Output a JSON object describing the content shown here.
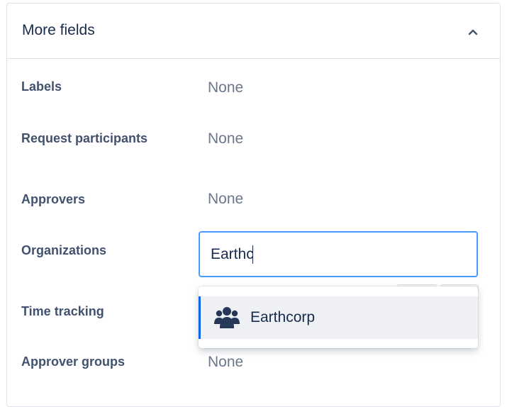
{
  "panel": {
    "title": "More fields"
  },
  "fields": {
    "labels": {
      "label": "Labels",
      "value": "None"
    },
    "request_participants": {
      "label": "Request participants",
      "value": "None"
    },
    "approvers": {
      "label": "Approvers",
      "value": "None"
    },
    "organizations": {
      "label": "Organizations",
      "input_value": "Earthc"
    },
    "time_tracking": {
      "label": "Time tracking"
    },
    "approver_groups": {
      "label": "Approver groups",
      "value": "None"
    }
  },
  "dropdown": {
    "options": [
      {
        "label": "Earthcorp",
        "icon": "people-group-icon"
      }
    ]
  },
  "colors": {
    "focus_border": "#4c9aff",
    "selected_bar": "#0c66e4",
    "icon": "#253858"
  }
}
